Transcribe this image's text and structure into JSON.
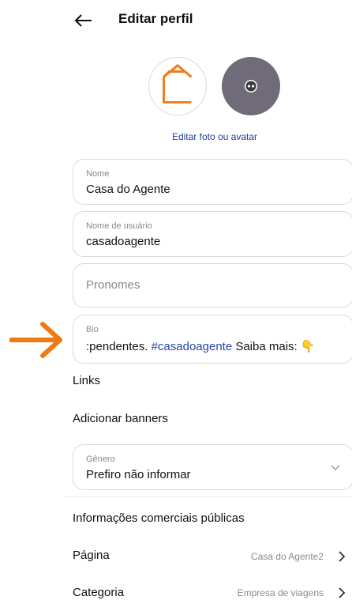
{
  "header": {
    "title": "Editar perfil"
  },
  "avatar": {
    "edit_label": "Editar foto ou avatar"
  },
  "fields": {
    "nome": {
      "label": "Nome",
      "value": "Casa do Agente"
    },
    "usuario": {
      "label": "Nome de usuário",
      "value": "casadoagente"
    },
    "pronomes": {
      "placeholder": "Pronomes"
    },
    "bio": {
      "label": "Bio",
      "value_pre": ":pendentes. ",
      "hashtag": "#casadoagente",
      "value_post": " Saiba mais: 👇"
    },
    "genero": {
      "label": "Gênero",
      "value": "Prefiro não informar"
    }
  },
  "links": {
    "label": "Links"
  },
  "banners": {
    "label": "Adicionar banners"
  },
  "business": {
    "section_title": "Informações comerciais públicas",
    "pagina": {
      "label": "Página",
      "value": "Casa do Agente2"
    },
    "categoria": {
      "label": "Categoria",
      "value": "Empresa de viagens"
    }
  },
  "colors": {
    "arrow": "#f07a12",
    "link": "#1c3f9c",
    "hashtag": "#2747a8"
  }
}
